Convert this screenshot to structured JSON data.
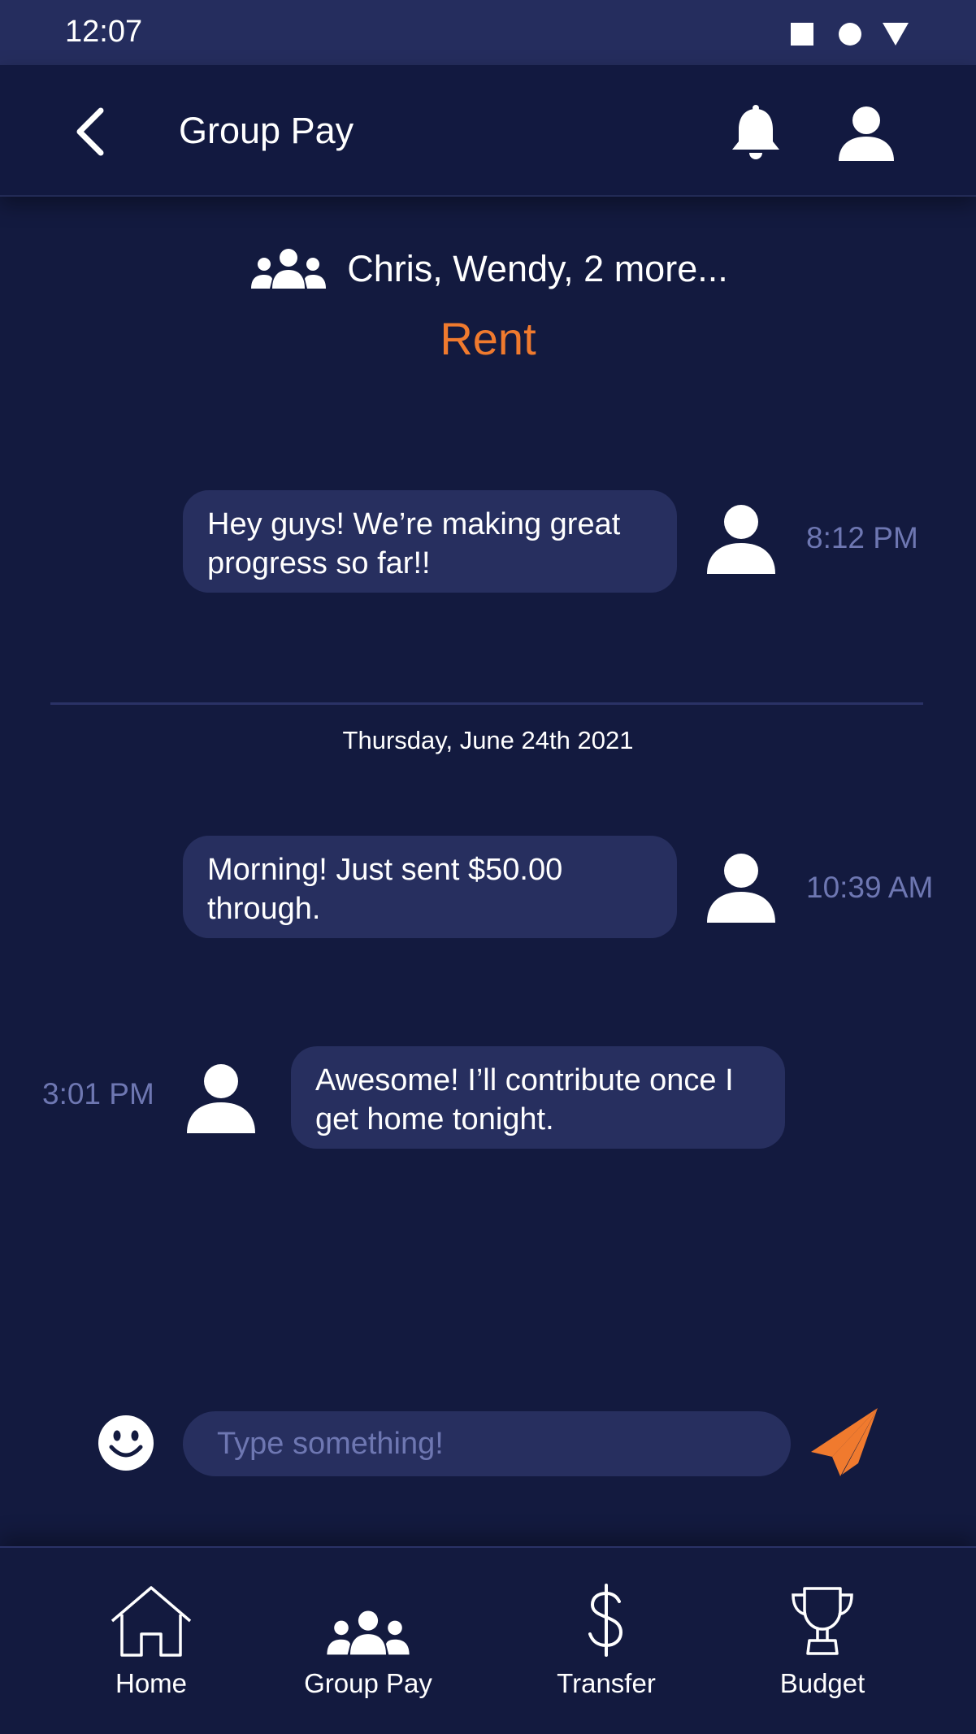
{
  "status_bar": {
    "time": "12:07"
  },
  "app_bar": {
    "title": "Group Pay"
  },
  "group": {
    "members": "Chris, Wendy, 2 more...",
    "name": "Rent"
  },
  "colors": {
    "background": "#131a3f",
    "bubble": "#272f5f",
    "accent": "#f07a2e",
    "muted_text": "#6e77b2"
  },
  "messages": [
    {
      "text": "Hey guys! We’re making great progress so far!!",
      "time": "8:12 PM",
      "side": "right"
    },
    {
      "text": "Morning! Just sent $50.00 through.",
      "time": "10:39 AM",
      "side": "right"
    },
    {
      "text": "Awesome! I’ll contribute once I get home tonight.",
      "time": "3:01 PM",
      "side": "left"
    }
  ],
  "date_separator": "Thursday, June 24th 2021",
  "composer": {
    "placeholder": "Type something!"
  },
  "nav": [
    {
      "label": "Home",
      "icon": "home-icon"
    },
    {
      "label": "Group Pay",
      "icon": "group-icon"
    },
    {
      "label": "Transfer",
      "icon": "dollar-icon"
    },
    {
      "label": "Budget",
      "icon": "trophy-icon"
    }
  ]
}
